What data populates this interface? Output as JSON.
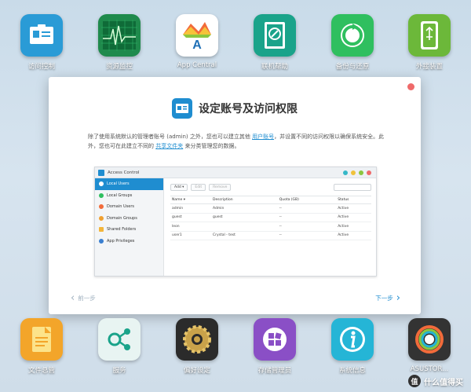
{
  "desktop": {
    "top_apps": [
      {
        "label": "访问控制",
        "icon": "access-control-icon",
        "color": "#2a9bd6"
      },
      {
        "label": "资源监控",
        "icon": "resource-monitor-icon",
        "color": "#1f8a4c"
      },
      {
        "label": "App Central",
        "icon": "app-central-icon",
        "color": "#ffffff"
      },
      {
        "label": "联机帮助",
        "icon": "online-help-icon",
        "color": "#1aa38a"
      },
      {
        "label": "备份与还原",
        "icon": "backup-restore-icon",
        "color": "#2fbf5f"
      },
      {
        "label": "外接装置",
        "icon": "external-device-icon",
        "color": "#6cb83a"
      }
    ],
    "bottom_apps": [
      {
        "label": "文件总管",
        "icon": "file-explorer-icon",
        "color": "#f3a52a"
      },
      {
        "label": "服务",
        "icon": "services-icon",
        "color": "#e8f4f2"
      },
      {
        "label": "偏好设定",
        "icon": "preferences-icon",
        "color": "#2b2b2b"
      },
      {
        "label": "存储管理员",
        "icon": "storage-manager-icon",
        "color": "#8a4fc6"
      },
      {
        "label": "系统信息",
        "icon": "system-info-icon",
        "color": "#25b5d6"
      },
      {
        "label": "ASUSTOR...",
        "icon": "asustor-icon",
        "color": "#333333"
      }
    ],
    "watermark": "什么值得买"
  },
  "dialog": {
    "title": "设定账号及访问权限",
    "desc_part1": "除了使用系统默认的管理者账号 (admin) 之外，您也可以建立其他 ",
    "desc_link1": "用户账号",
    "desc_part2": "，并设置不同的访问权限以确保系统安全。此外，您也可在此建立不同的 ",
    "desc_link2": "共享文件夹",
    "desc_part3": " 来分类管理您的数据。",
    "prev_label": "前一步",
    "next_label": "下一步"
  },
  "preview": {
    "window_title": "Access Control",
    "sidebar": [
      "Local Users",
      "Local Groups",
      "Domain Users",
      "Domain Groups",
      "Shared Folders",
      "App Privileges"
    ],
    "toolbar": {
      "add": "Add ▾",
      "edit": "Edit",
      "remove": "Remove"
    },
    "columns": [
      "Name ▾",
      "Description",
      "Quota (GB)",
      "Status"
    ],
    "rows": [
      [
        "admin",
        "Admin",
        "--",
        "Active"
      ],
      [
        "guest",
        "guest",
        "--",
        "Active"
      ],
      [
        "leon",
        "",
        "--",
        "Active"
      ],
      [
        "user1",
        "Crystal - test",
        "--",
        "Active"
      ]
    ]
  }
}
